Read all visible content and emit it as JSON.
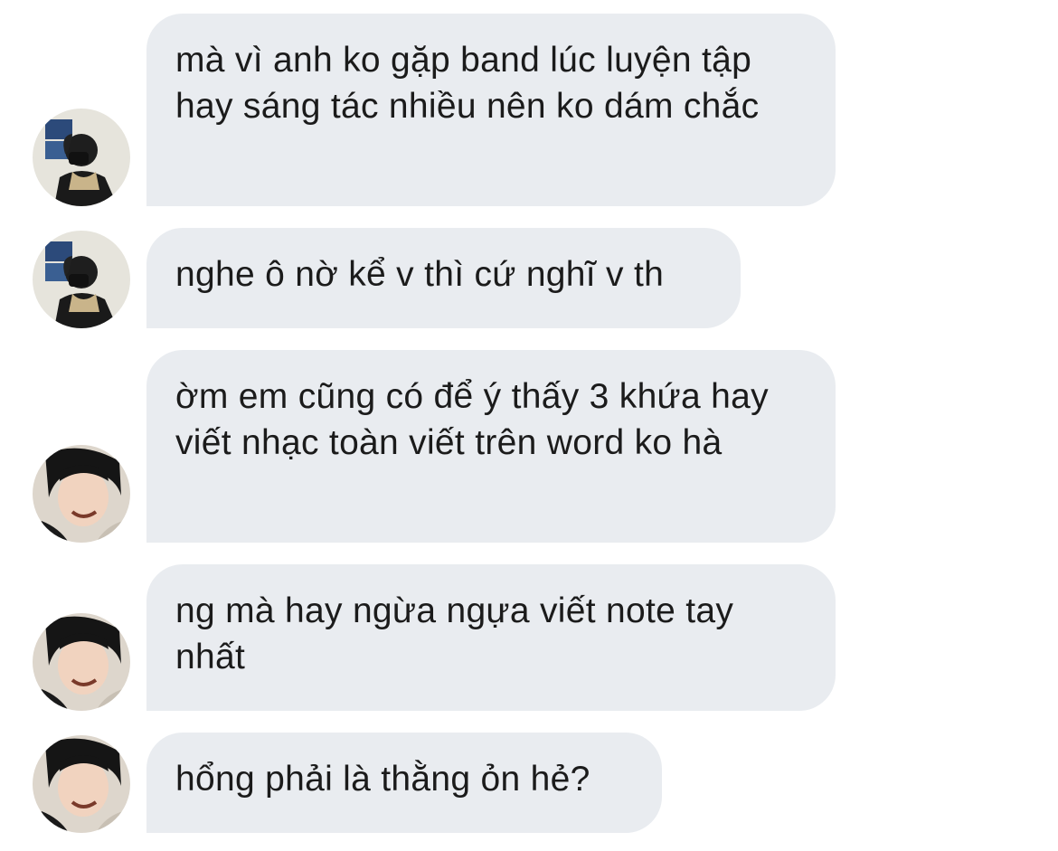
{
  "conversation": {
    "messages": [
      {
        "sender": "avatar-a",
        "text": "mà vì anh ko gặp band lúc luyện tập hay sáng tác nhiều nên ko dám chắc"
      },
      {
        "sender": "avatar-a",
        "text": "nghe ô nờ kể v thì cứ nghĩ v th"
      },
      {
        "sender": "avatar-b",
        "text": "ờm em cũng có để ý thấy 3 khứa hay viết nhạc toàn viết trên word ko hà"
      },
      {
        "sender": "avatar-b",
        "text": "ng mà hay ngừa ngựa viết note tay nhất"
      },
      {
        "sender": "avatar-b",
        "text": "hổng phải là thằng ỏn hẻ?"
      }
    ]
  },
  "colors": {
    "bubble_bg": "#e9ecf0",
    "text": "#1b1b1b",
    "background": "#ffffff"
  }
}
